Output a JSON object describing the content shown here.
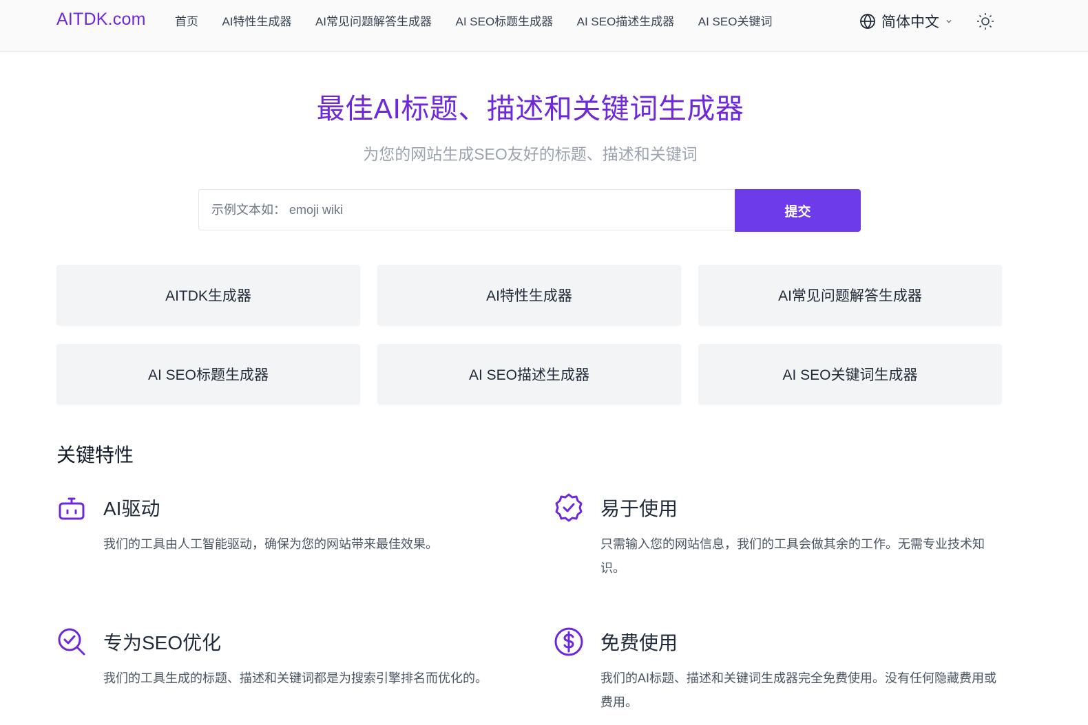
{
  "header": {
    "logo": "AITDK.com",
    "nav": [
      "首页",
      "AI特性生成器",
      "AI常见问题解答生成器",
      "AI SEO标题生成器",
      "AI SEO描述生成器",
      "AI SEO关键词"
    ],
    "language": "简体中文",
    "icons": [
      "globe-icon",
      "chevron-down-icon",
      "sun-icon"
    ]
  },
  "hero": {
    "title": "最佳AI标题、描述和关键词生成器",
    "subtitle": "为您的网站生成SEO友好的标题、描述和关键词",
    "search_placeholder": "示例文本如： emoji wiki",
    "submit_label": "提交"
  },
  "cards": [
    "AITDK生成器",
    "AI特性生成器",
    "AI常见问题解答生成器",
    "AI SEO标题生成器",
    "AI SEO描述生成器",
    "AI SEO关键词生成器"
  ],
  "features": {
    "section_title": "关键特性",
    "items": [
      {
        "icon": "robot-icon",
        "title": "AI驱动",
        "desc": "我们的工具由人工智能驱动，确保为您的网站带来最佳效果。"
      },
      {
        "icon": "badge-check-icon",
        "title": "易于使用",
        "desc": "只需输入您的网站信息，我们的工具会做其余的工作。无需专业技术知识。"
      },
      {
        "icon": "search-check-icon",
        "title": "专为SEO优化",
        "desc": "我们的工具生成的标题、描述和关键词都是为搜索引擎排名而优化的。"
      },
      {
        "icon": "dollar-icon",
        "title": "免费使用",
        "desc": "我们的AI标题、描述和关键词生成器完全免费使用。没有任何隐藏费用或费用。"
      }
    ]
  },
  "colors": {
    "accent": "#6d28d9",
    "button": "#6d3bea",
    "card_bg": "#f3f4f6"
  }
}
